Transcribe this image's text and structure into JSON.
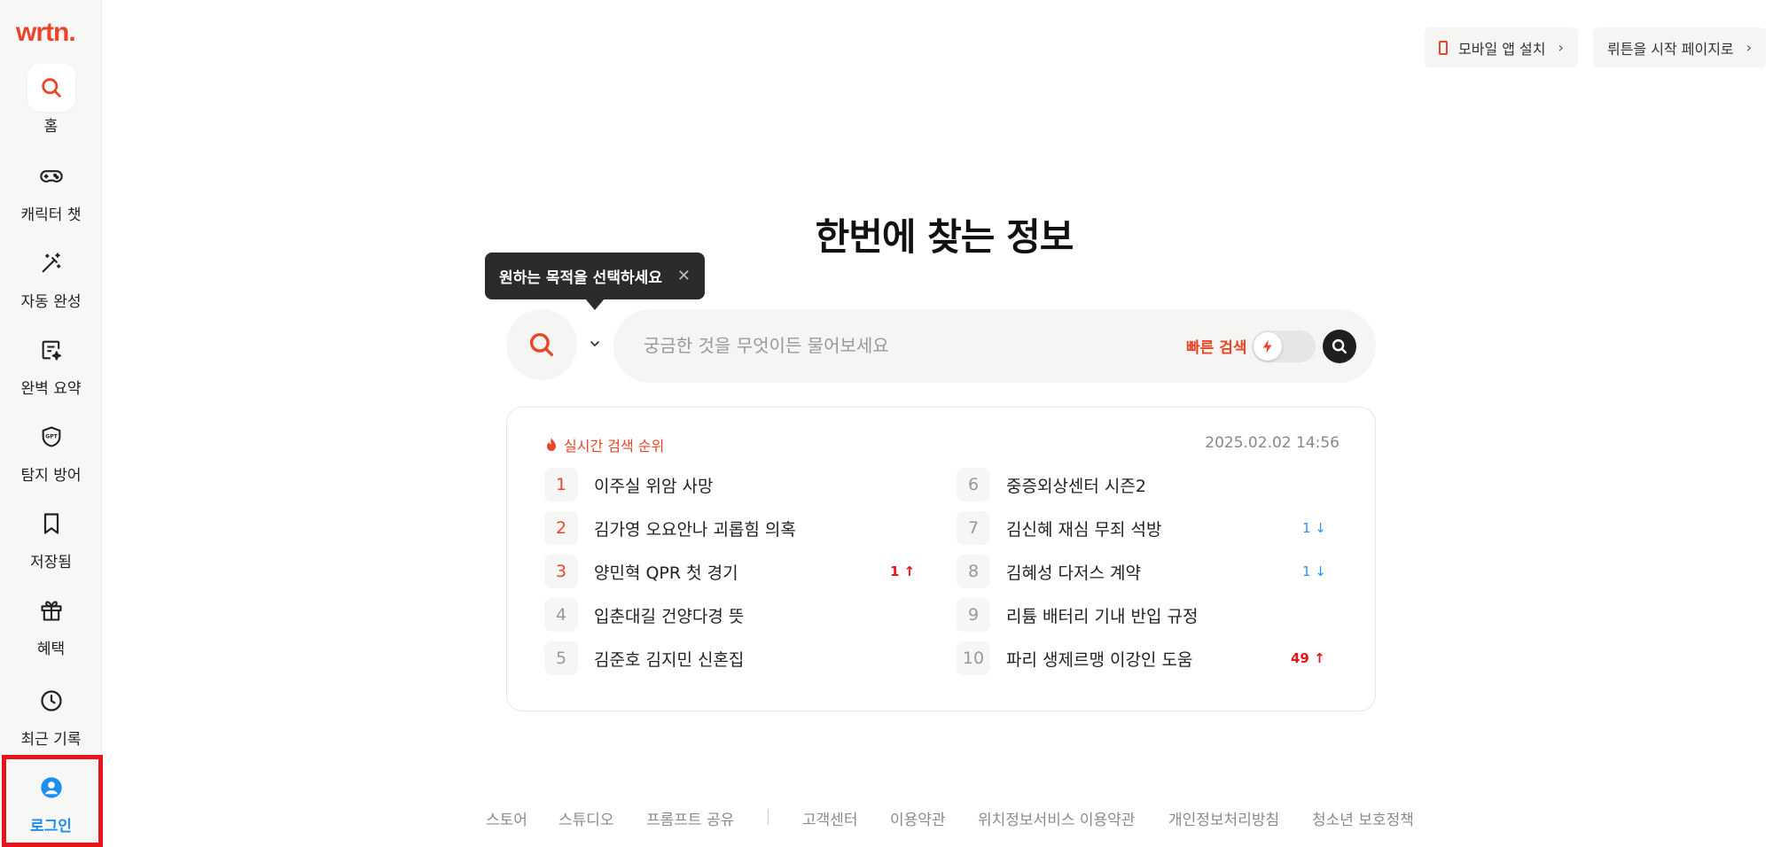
{
  "brand": {
    "logo_text": "wrtn."
  },
  "sidebar": {
    "items": [
      {
        "label": "홈",
        "icon": "search-icon",
        "active": true
      },
      {
        "label": "캐릭터 챗",
        "icon": "gamepad-icon"
      },
      {
        "label": "자동 완성",
        "icon": "magic-wand-icon"
      },
      {
        "label": "완벽 요약",
        "icon": "document-sparkle-icon"
      },
      {
        "label": "탐지 방어",
        "icon": "shield-gpt-icon",
        "badge": "GPT"
      },
      {
        "label": "저장됨",
        "icon": "bookmark-icon"
      },
      {
        "label": "혜택",
        "icon": "gift-icon"
      },
      {
        "label": "최근 기록",
        "icon": "clock-icon"
      },
      {
        "label": "로그인",
        "icon": "user-circle-icon"
      }
    ]
  },
  "top_buttons": {
    "mobile_app": "모바일 앱 설치",
    "start_page": "뤼튼을 시작 페이지로"
  },
  "main": {
    "headline": "한번에 찾는 정보",
    "tooltip": "원하는 목적을 선택하세요",
    "search": {
      "placeholder": "궁금한 것을 무엇이든 물어보세요",
      "quick_search_label": "빠른 검색",
      "quick_search_on": false
    }
  },
  "trending": {
    "title": "실시간 검색 순위",
    "timestamp": "2025.02.02 14:56",
    "items": [
      {
        "rank": "1",
        "text": "이주실 위암 사망",
        "change": ""
      },
      {
        "rank": "2",
        "text": "김가영 오요안나 괴롭힘 의혹",
        "change": ""
      },
      {
        "rank": "3",
        "text": "양민혁 QPR 첫 경기",
        "change": "1 ↑",
        "dir": "up"
      },
      {
        "rank": "4",
        "text": "입춘대길 건양다경 뜻",
        "change": ""
      },
      {
        "rank": "5",
        "text": "김준호 김지민 신혼집",
        "change": ""
      },
      {
        "rank": "6",
        "text": "중증외상센터 시즌2",
        "change": ""
      },
      {
        "rank": "7",
        "text": "김신혜 재심 무죄 석방",
        "change": "1 ↓",
        "dir": "down"
      },
      {
        "rank": "8",
        "text": "김혜성 다저스 계약",
        "change": "1 ↓",
        "dir": "down"
      },
      {
        "rank": "9",
        "text": "리튬 배터리 기내 반입 규정",
        "change": ""
      },
      {
        "rank": "10",
        "text": "파리 생제르맹 이강인 도움",
        "change": "49 ↑",
        "dir": "up"
      }
    ]
  },
  "footer": {
    "links": [
      "스토어",
      "스튜디오",
      "프롬프트 공유",
      "고객센터",
      "이용약관",
      "위치정보서비스 이용약관",
      "개인정보처리방침",
      "청소년 보호정책"
    ]
  },
  "colors": {
    "accent": "#e8462a",
    "login_blue": "#1d8ef0",
    "up": "#e8141b",
    "down": "#2a93f2"
  }
}
